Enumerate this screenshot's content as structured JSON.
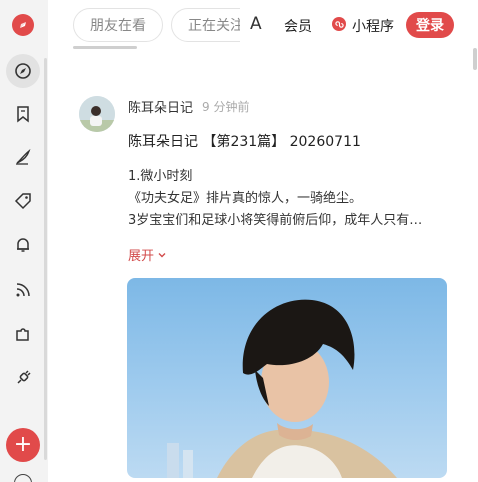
{
  "colors": {
    "accent": "#e14a4a",
    "expand": "#d24b4b"
  },
  "sidebar": {
    "icons": [
      "logo-icon",
      "compass-icon",
      "bookmark-icon",
      "pen-icon",
      "tag-icon",
      "bell-icon",
      "rss-icon",
      "puzzle-icon",
      "plugin-icon",
      "add-icon"
    ]
  },
  "top_tabs": [
    {
      "label": "朋友在看"
    },
    {
      "label": "正在关注"
    }
  ],
  "header": {
    "font_label": "A",
    "vip_label": "会员",
    "mini_program_label": "小程序",
    "login_label": "登录"
  },
  "post": {
    "author": "陈耳朵日记",
    "time": "9 分钟前",
    "title": "陈耳朵日记 【第231篇】 20260711",
    "lines": [
      "1.微小时刻",
      "《功夫女足》排片真的惊人，一骑绝尘。",
      "3岁宝宝们和足球小将笑得前俯后仰，成年人只有…"
    ],
    "expand_label": "展开"
  }
}
